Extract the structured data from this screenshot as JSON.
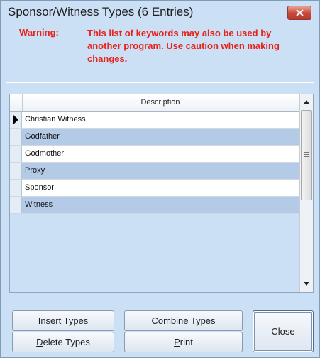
{
  "window": {
    "title": "Sponsor/Witness Types (6 Entries)"
  },
  "warning": {
    "label": "Warning:",
    "text": "This list of keywords may also be used by another program. Use caution when making changes."
  },
  "grid": {
    "column_header": "Description",
    "selected_row": 0,
    "rows": [
      "Christian Witness",
      "Godfather",
      "Godmother",
      "Proxy",
      "Sponsor",
      "Witness"
    ]
  },
  "buttons": {
    "insert": {
      "pre": "",
      "acc": "I",
      "post": "nsert Types"
    },
    "delete": {
      "pre": "",
      "acc": "D",
      "post": "elete Types"
    },
    "combine": {
      "pre": "",
      "acc": "C",
      "post": "ombine Types"
    },
    "print": {
      "pre": "",
      "acc": "P",
      "post": "rint"
    },
    "close": "Close"
  },
  "colors": {
    "window_bg": "#cbdff5",
    "warning_text": "#e8221b",
    "row_alt": "#b3cbe6"
  },
  "icons": {
    "close": "close-x-icon",
    "row_indicator": "row-pointer-icon",
    "scroll_up": "arrow-up-icon",
    "scroll_down": "arrow-down-icon"
  }
}
